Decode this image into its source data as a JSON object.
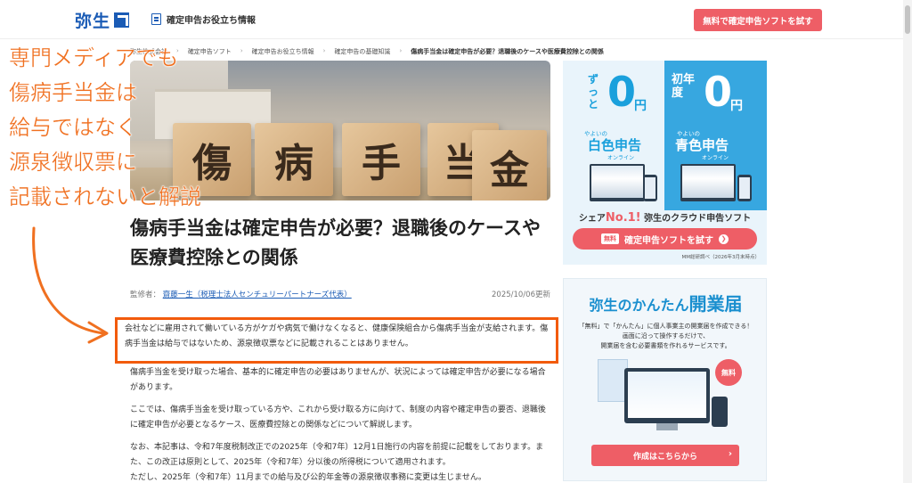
{
  "header": {
    "logo": "弥生",
    "site_title": "確定申告お役立ち情報",
    "cta": "無料で確定申告ソフトを試す"
  },
  "breadcrumb": [
    "弥生株式会社",
    "確定申告ソフト",
    "確定申告お役立ち情報",
    "確定申告の基礎知識",
    "傷病手当金は確定申告が必要？退職後のケースや医療費控除との関係"
  ],
  "hero": {
    "blocks": [
      "傷",
      "病",
      "手",
      "当",
      "金"
    ]
  },
  "article": {
    "title": "傷病手当金は確定申告が必要？退職後のケースや医療費控除との関係",
    "supervisor_label": "監修者：",
    "supervisor_name": "齋藤一生（税理士法人センチュリーパートナーズ代表）",
    "updated": "2025/10/06更新",
    "paragraphs": [
      "会社などに雇用されて働いている方がケガや病気で働けなくなると、健康保険組合から傷病手当金が支給されます。傷病手当金は給与ではないため、源泉徴収票などに記載されることはありません。",
      "傷病手当金を受け取った場合、基本的に確定申告の必要はありませんが、状況によっては確定申告が必要になる場合があります。",
      "ここでは、傷病手当金を受け取っている方や、これから受け取る方に向けて、制度の内容や確定申告の要否、退職後に確定申告が必要となるケース、医療費控除との関係などについて解説します。",
      "なお、本記事は、令和7年度税制改正での2025年（令和7年）12月1日施行の内容を前提に記載をしております。また、この改正は原則として、2025年（令和7年）分以後の所得税について適用されます。",
      "ただし、2025年（令和7年）11月までの給与及び公的年金等の源泉徴収事務に変更は生じません。"
    ]
  },
  "annotation": {
    "lines": [
      "専門メディアでも",
      "傷病手当金は",
      "給与ではなく",
      "源泉徴収票に",
      "記載されないと解説"
    ],
    "color": "#f07020"
  },
  "ad1": {
    "left": {
      "prefix": "ずっと",
      "amount": "0",
      "unit": "円",
      "brand": "やよいの",
      "product": "白色申告",
      "sub": "オンライン"
    },
    "right": {
      "prefix": "初年度",
      "amount": "0",
      "unit": "円",
      "brand": "やよいの",
      "product": "青色申告",
      "sub": "オンライン"
    },
    "share_pre": "シェア",
    "share_no1": "No.1!",
    "share_post": "弥生のクラウド申告ソフト",
    "btn_badge": "無料",
    "btn_label": "確定申告ソフトを試す",
    "note": "MM総研調べ（2026年3月末時点）"
  },
  "ad2": {
    "title_pre": "弥生のかんたん",
    "title_big": "開業届",
    "desc": [
      "「無料」で「かんたん」に個人事業主の開業届を作成できる！",
      "画面に沿って操作するだけで、",
      "開業届を含む必要書類を作れるサービスです。"
    ],
    "badge": "無料",
    "btn_label": "作成はこちらから"
  },
  "colors": {
    "brand_blue": "#1a5bb5",
    "cta_red": "#ee5e66",
    "highlight_orange": "#f25b0c"
  }
}
